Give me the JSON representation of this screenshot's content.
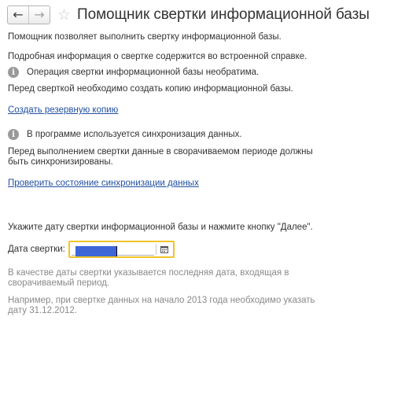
{
  "header": {
    "back_glyph": "←",
    "forward_glyph": "→",
    "star_glyph": "☆",
    "title": "Помощник свертки информационной базы"
  },
  "content": {
    "intro": "Помощник позволяет выполнить свертку информационной базы.",
    "details": "Подробная информация о свертке содержится во встроенной справке.",
    "warning1": "Операция свертки информационной базы необратима.",
    "backup_note": "Перед сверткой необходимо создать копию информационной базы.",
    "backup_link": "Создать резервную копию",
    "warning2": "В программе используется синхронизация данных.",
    "sync_note": "Перед выполнением свертки данные в сворачиваемом периоде должны быть синхронизированы.",
    "sync_link": "Проверить состояние синхронизации данных",
    "date_prompt": "Укажите дату свертки информационной базы и нажмите кнопку \"Далее\".",
    "date_label": "Дата свертки:",
    "hint1": "В качестве даты свертки указывается последняя дата, входящая в сворачиваемый период.",
    "hint2": "Например, при свертке данных на начало 2013 года необходимо указать дату 31.12.2012."
  },
  "icons": {
    "back": "arrow-left-icon",
    "forward": "arrow-right-icon",
    "favorite": "star-icon",
    "info": "info-icon",
    "calendar": "calendar-icon"
  },
  "colors": {
    "link": "#2150a0",
    "focus_border": "#f0c429",
    "selection": "#3e66d6",
    "hint_text": "#8a8a8a"
  }
}
